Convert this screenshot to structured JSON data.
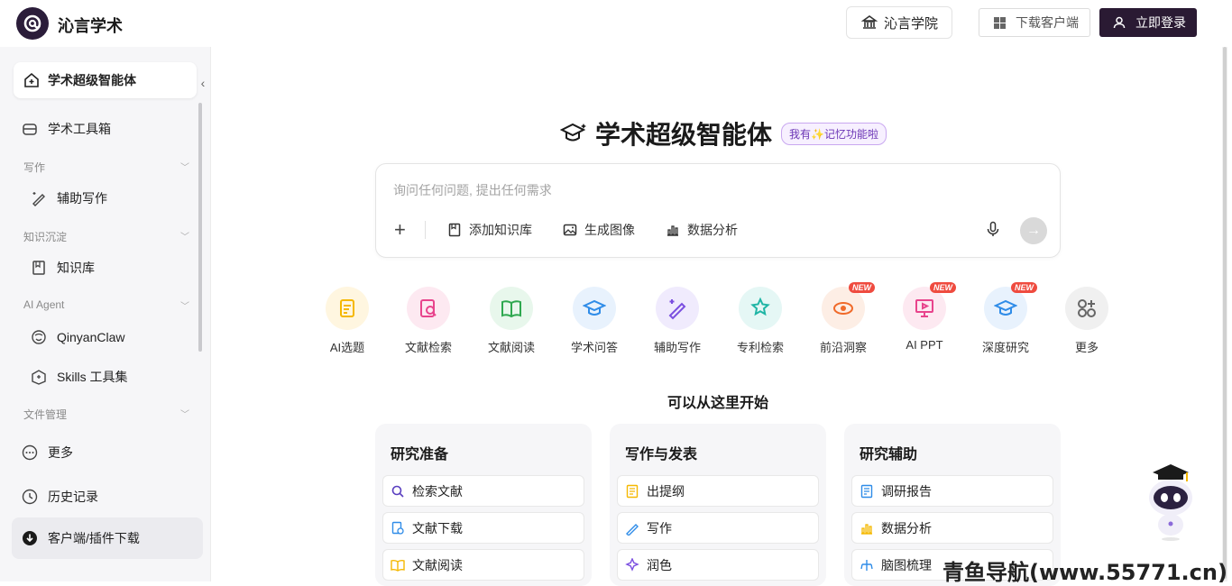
{
  "header": {
    "logo_text": "沁言学术",
    "academy_label": "沁言学院",
    "download_label": "下载客户端",
    "login_label": "立即登录"
  },
  "sidebar": {
    "active_item": "学术超级智能体",
    "toolbox": "学术工具箱",
    "sections": {
      "writing": "写作",
      "knowledge": "知识沉淀",
      "agent": "AI Agent",
      "files": "文件管理"
    },
    "items": {
      "assist_writing": "辅助写作",
      "knowledge_base": "知识库",
      "qinyanclaw": "QinyanClaw",
      "skills": "Skills 工具集"
    },
    "more": "更多",
    "history": "历史记录",
    "client_download": "客户端/插件下载"
  },
  "main": {
    "title": "学术超级智能体",
    "memory_badge": "我有✨记忆功能啦",
    "input_placeholder": "询问任何问题, 提出任何需求",
    "tools": [
      "添加知识库",
      "生成图像",
      "数据分析"
    ],
    "features": [
      {
        "label": "AI选题",
        "color": "#f5b800",
        "bg": "#fff6e0",
        "new": false
      },
      {
        "label": "文献检索",
        "color": "#e8448c",
        "bg": "#fde9f1",
        "new": false
      },
      {
        "label": "文献阅读",
        "color": "#2ea84f",
        "bg": "#e8f7ec",
        "new": false
      },
      {
        "label": "学术问答",
        "color": "#2f8ce8",
        "bg": "#e8f2fd",
        "new": false
      },
      {
        "label": "辅助写作",
        "color": "#7b4fe0",
        "bg": "#f0ebfd",
        "new": false
      },
      {
        "label": "专利检索",
        "color": "#1fb5a5",
        "bg": "#e5f7f5",
        "new": false
      },
      {
        "label": "前沿洞察",
        "color": "#f06a2a",
        "bg": "#fdeee5",
        "new": true
      },
      {
        "label": "AI PPT",
        "color": "#e8448c",
        "bg": "#fde9f1",
        "new": true
      },
      {
        "label": "深度研究",
        "color": "#2f8ce8",
        "bg": "#e8f2fd",
        "new": true
      },
      {
        "label": "更多",
        "color": "#666666",
        "bg": "#f0f0f0",
        "new": false
      }
    ],
    "new_label": "NEW",
    "start_title": "可以从这里开始",
    "cards": [
      {
        "title": "研究准备",
        "rows": [
          "检索文献",
          "文献下载",
          "文献阅读"
        ]
      },
      {
        "title": "写作与发表",
        "rows": [
          "出提纲",
          "写作",
          "润色"
        ]
      },
      {
        "title": "研究辅助",
        "rows": [
          "调研报告",
          "数据分析",
          "脑图梳理"
        ]
      }
    ]
  },
  "watermark": "青鱼导航(www.55771.cn)"
}
